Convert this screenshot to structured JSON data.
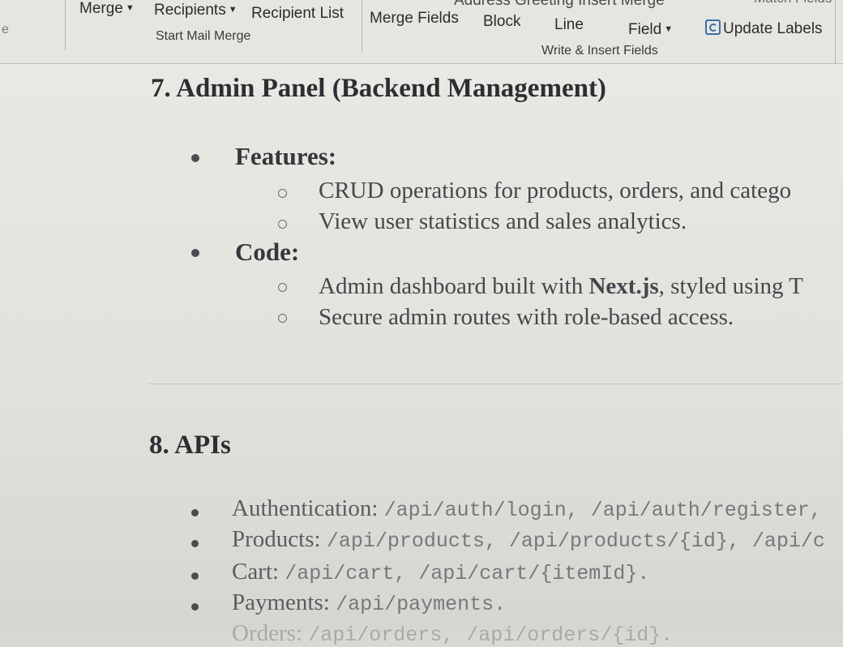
{
  "ribbon": {
    "partial_left": "e",
    "merge": "Merge",
    "recipients": "Recipients",
    "recipient_list": "Recipient List",
    "start_mail_merge": "Start Mail Merge",
    "merge_fields": "Merge Fields",
    "block": "Block",
    "address_greeting_partial": "Address Greeting Insert Merge",
    "line": "Line",
    "field": "Field",
    "match_fields_partial": "Match Fields",
    "update_labels": "Update Labels",
    "write_insert_fields": "Write & Insert Fields"
  },
  "section7": {
    "heading": "7. Admin Panel (Backend Management)",
    "features_label": "Features:",
    "features": [
      "CRUD operations for products, orders, and catego",
      "View user statistics and sales analytics."
    ],
    "code_label": "Code:",
    "code_item1_pre": "Admin dashboard built with ",
    "code_item1_bold": "Next.js",
    "code_item1_post": ", styled using T",
    "code_item2": "Secure admin routes with role-based access."
  },
  "section8": {
    "heading": "8. APIs",
    "apis": [
      {
        "label": "Authentication:",
        "code": "/api/auth/login, /api/auth/register,"
      },
      {
        "label": "Products:",
        "code": "/api/products, /api/products/{id}, /api/c"
      },
      {
        "label": "Cart:",
        "code": "/api/cart, /api/cart/{itemId}."
      },
      {
        "label": "Payments:",
        "code": "/api/payments."
      },
      {
        "label": "Orders:",
        "code": "/api/orders, /api/orders/{id}."
      }
    ]
  }
}
